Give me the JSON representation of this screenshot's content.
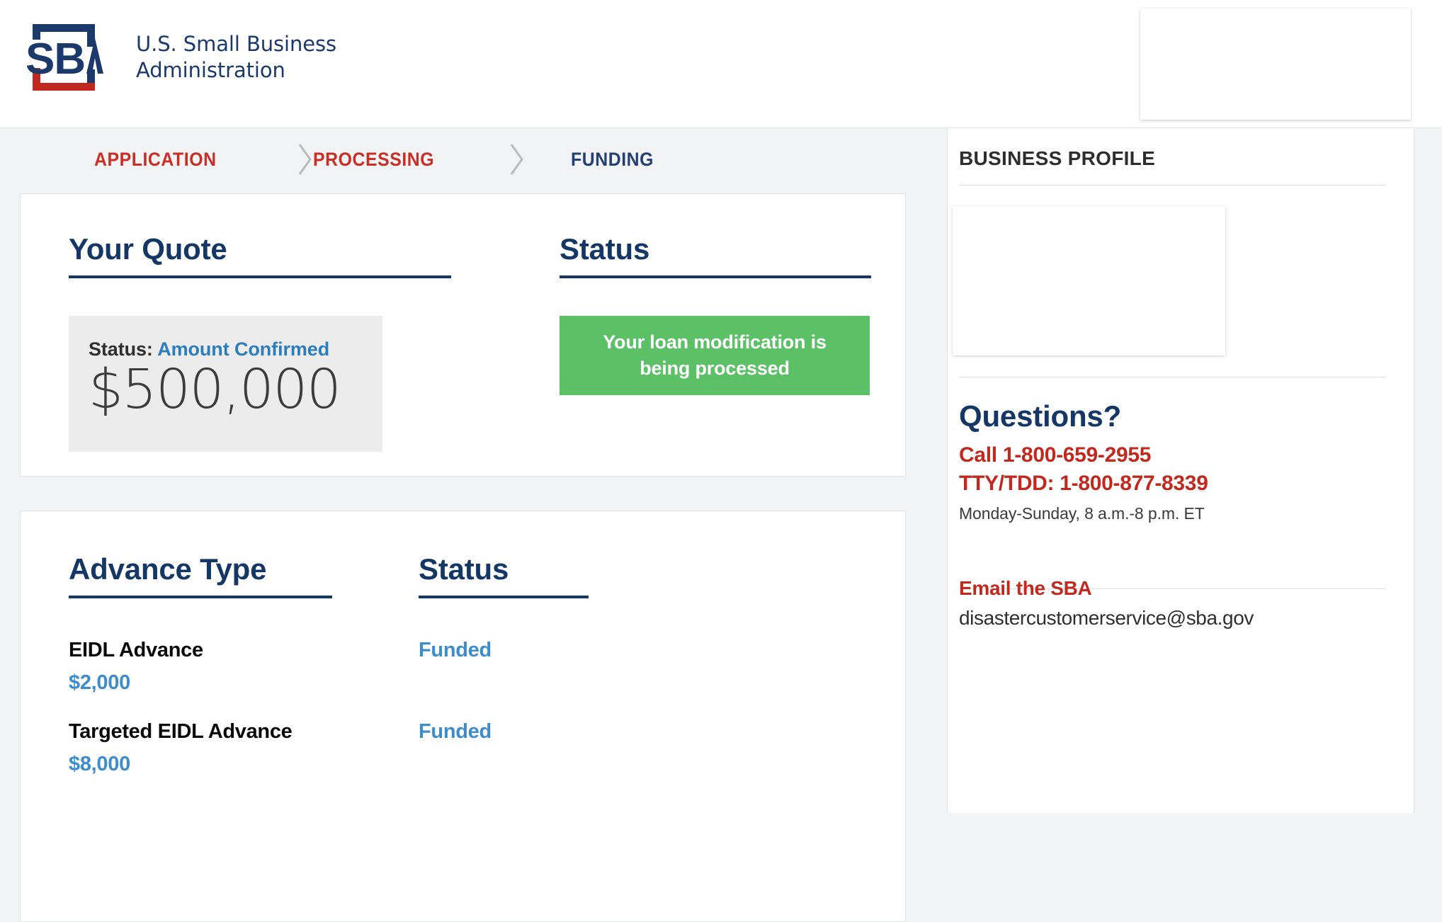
{
  "header": {
    "logo_alt": "SBA",
    "agency_name": "U.S. Small Business\nAdministration",
    "widget_label": ""
  },
  "colors": {
    "brand_navy": "#143765",
    "brand_red": "#c1291f",
    "link_blue": "#3d8dcc",
    "status_green": "#5cc067",
    "page_bg": "#f2f3f5"
  },
  "breadcrumb": {
    "steps": [
      {
        "label": "APPLICATION",
        "state": "complete"
      },
      {
        "label": "PROCESSING",
        "state": "complete"
      },
      {
        "label": "FUNDING",
        "state": "current"
      }
    ],
    "separator": "chevron-right"
  },
  "quote_card": {
    "heading": "Your Quote",
    "status_label": "Status:",
    "status_value": "Amount Confirmed",
    "amount": "$500,000"
  },
  "status_card": {
    "heading": "Status",
    "banner_text": "Your loan modification is being processed"
  },
  "advance_card": {
    "columns": [
      "Advance Type",
      "Status"
    ],
    "rows": [
      {
        "type": "EIDL Advance",
        "amount": "$2,000",
        "status": "Funded"
      },
      {
        "type": "Targeted EIDL Advance",
        "amount": "$8,000",
        "status": "Funded"
      }
    ]
  },
  "sidebar": {
    "title": "BUSINESS PROFILE",
    "profile_card_content": "",
    "questions_heading": "Questions?",
    "phone_primary": "Call 1-800-659-2955",
    "phone_tty": "TTY/TDD: 1-800-877-8339",
    "hours": "Monday-Sunday, 8 a.m.-8 p.m. ET",
    "email_heading": "Email the SBA",
    "email_address": "disastercustomerservice@sba.gov"
  }
}
